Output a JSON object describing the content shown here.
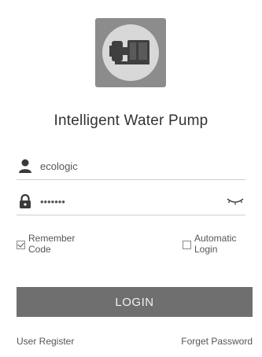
{
  "app": {
    "title": "Intelligent Water Pump",
    "logo_icon": "water-pump-icon"
  },
  "form": {
    "username": {
      "value": "ecologic",
      "icon": "user-icon"
    },
    "password": {
      "value": "•••••••",
      "icon": "lock-icon",
      "toggle_icon": "eye-icon"
    }
  },
  "options": {
    "remember": {
      "label_line1": "Remember",
      "label_line2": "Code",
      "checked": true
    },
    "automatic": {
      "label_line1": "Automatic",
      "label_line2": "Login",
      "checked": false
    }
  },
  "login_button": {
    "label": "LOGIN"
  },
  "links": {
    "register": "User Register",
    "forgot": "Forget Password"
  },
  "colors": {
    "button": "#6f6f6f",
    "logo_bg": "#8c8c8c",
    "divider": "#cfcfcf"
  }
}
